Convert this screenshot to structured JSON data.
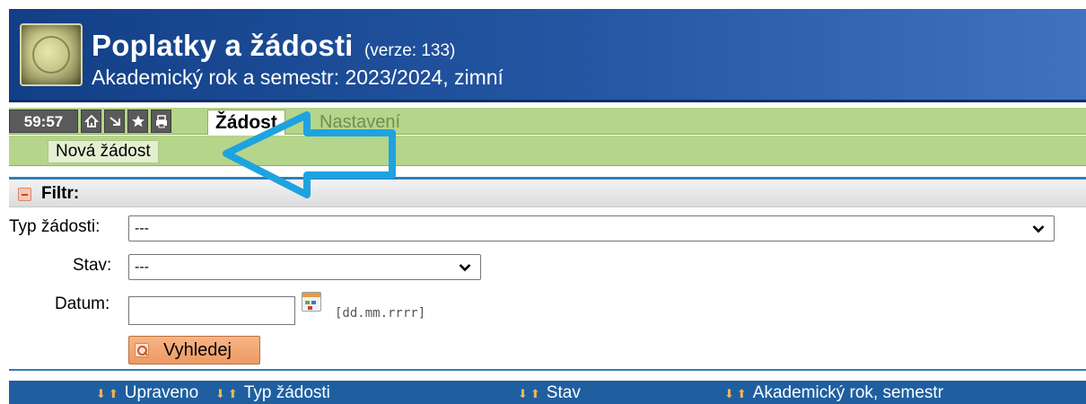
{
  "header": {
    "title": "Poplatky a žádosti",
    "version": "(verze: 133)",
    "subtitle": "Akademický rok a semestr: 2023/2024, zimní"
  },
  "toolbar": {
    "timer": "59:57",
    "icons": [
      "home-icon",
      "exit-icon",
      "star-icon",
      "print-icon"
    ],
    "tabs": [
      {
        "label": "Žádost",
        "active": true
      },
      {
        "label": "Nastavení",
        "active": false
      }
    ]
  },
  "subnav": {
    "items": [
      "Nová žádost"
    ]
  },
  "filter": {
    "title": "Filtr:",
    "type_label": "Typ žádosti:",
    "type_value": "---",
    "status_label": "Stav:",
    "status_value": "---",
    "date_label": "Datum:",
    "date_value": "",
    "date_hint": "[dd.mm.rrrr]",
    "search_label": "Vyhledej"
  },
  "table": {
    "columns": [
      "Upraveno",
      "Typ žádosti",
      "Stav",
      "Akademický rok, semestr"
    ]
  },
  "colors": {
    "header_blue": "#1a4a96",
    "toolbar_green": "#b5d58a",
    "table_head_blue": "#1f5fa0",
    "arrow_blue": "#1ea3e0",
    "button_orange": "#f0a06c"
  }
}
